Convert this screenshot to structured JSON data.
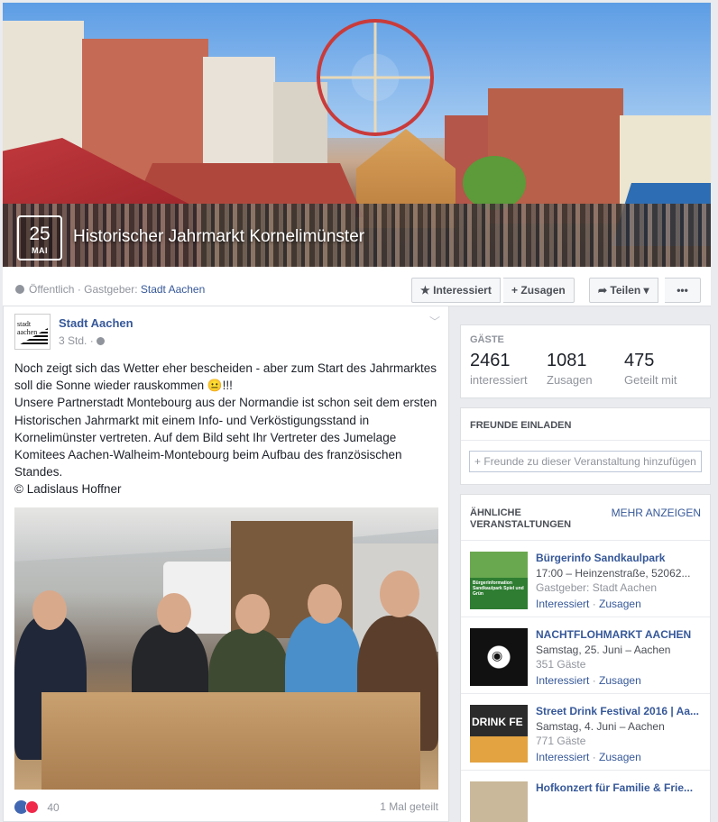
{
  "event": {
    "date_day": "25",
    "date_month": "MAI",
    "title": "Historischer Jahrmarkt Kornelimünster",
    "visibility": "Öffentlich",
    "host_prefix": "· Gastgeber:",
    "host": "Stadt Aachen"
  },
  "actions": {
    "interested": "Interessiert",
    "going": "Zusagen",
    "share": "Teilen",
    "more": "•••"
  },
  "icons": {
    "interested": "star-icon",
    "going": "plus-icon",
    "share": "share-arrow-icon",
    "share_caret": "caret-down-icon",
    "globe": "globe-icon",
    "post_menu": "chevron-down-icon",
    "like": "like-reaction-icon",
    "love": "love-reaction-icon"
  },
  "post": {
    "author": "Stadt Aachen",
    "logo_text": "stadt aachen",
    "time": "3 Std. ·",
    "text": "Noch zeigt sich das Wetter eher bescheiden - aber zum Start des Jahrmarktes soll die Sonne wieder rauskommen 😐!!!\nUnsere Partnerstadt Montebourg aus der Normandie ist schon seit dem ersten Historischen Jahrmarkt mit einem Info- und Verköstigungsstand in Kornelimünster vertreten. Auf dem Bild seht Ihr Vertreter des Jumelage Komitees Aachen-Walheim-Montebourg beim Aufbau des französischen Standes.\n© Ladislaus Hoffner",
    "reactions": "40",
    "shares": "1 Mal geteilt"
  },
  "guests": {
    "heading": "GÄSTE",
    "stats": [
      {
        "value": "2461",
        "label": "interessiert"
      },
      {
        "value": "1081",
        "label": "Zusagen"
      },
      {
        "value": "475",
        "label": "Geteilt mit"
      }
    ]
  },
  "invite": {
    "heading": "FREUNDE EINLADEN",
    "placeholder": "+ Freunde zu dieser Veranstaltung hinzufügen"
  },
  "similar": {
    "heading": "ÄHNLICHE VERANSTALTUNGEN",
    "more": "MEHR ANZEIGEN",
    "items": [
      {
        "title": "Bürgerinfo Sandkaulpark",
        "line1": "17:00 – Heinzenstraße, 52062...",
        "line2": "Gastgeber: Stadt Aachen",
        "interested": "Interessiert",
        "going": "Zusagen",
        "thumb_text": "Bürgerinformation Sandkaulpark Spiel und Grün"
      },
      {
        "title": "NACHTFLOHMARKT AACHEN",
        "line1": "Samstag, 25. Juni – Aachen",
        "line2": "351 Gäste",
        "interested": "Interessiert",
        "going": "Zusagen",
        "thumb_text": ""
      },
      {
        "title": "Street Drink Festival 2016 | Aa...",
        "line1": "Samstag, 4. Juni – Aachen",
        "line2": "771 Gäste",
        "interested": "Interessiert",
        "going": "Zusagen",
        "thumb_text": "DRINK FE"
      },
      {
        "title": "Hofkonzert für Familie & Frie...",
        "line1": "",
        "line2": "",
        "interested": "",
        "going": "",
        "thumb_text": ""
      }
    ]
  },
  "colors": {
    "link": "#365899",
    "page_bg": "#e9ebee",
    "muted": "#90949c"
  }
}
